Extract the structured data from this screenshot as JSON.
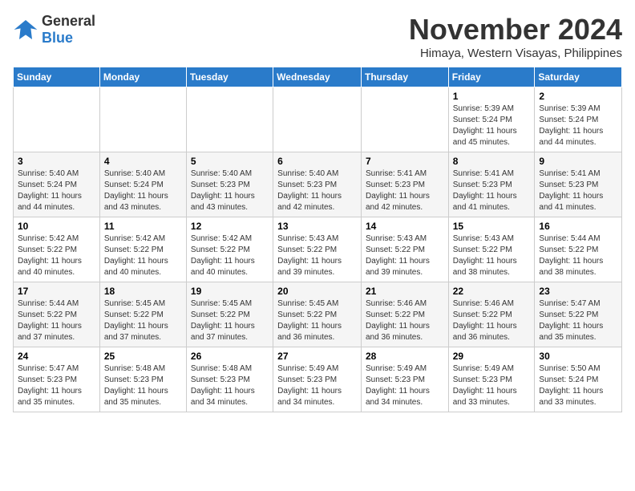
{
  "logo": {
    "line1": "General",
    "line2": "Blue"
  },
  "title": "November 2024",
  "location": "Himaya, Western Visayas, Philippines",
  "weekdays": [
    "Sunday",
    "Monday",
    "Tuesday",
    "Wednesday",
    "Thursday",
    "Friday",
    "Saturday"
  ],
  "weeks": [
    [
      {
        "day": "",
        "info": ""
      },
      {
        "day": "",
        "info": ""
      },
      {
        "day": "",
        "info": ""
      },
      {
        "day": "",
        "info": ""
      },
      {
        "day": "",
        "info": ""
      },
      {
        "day": "1",
        "info": "Sunrise: 5:39 AM\nSunset: 5:24 PM\nDaylight: 11 hours and 45 minutes."
      },
      {
        "day": "2",
        "info": "Sunrise: 5:39 AM\nSunset: 5:24 PM\nDaylight: 11 hours and 44 minutes."
      }
    ],
    [
      {
        "day": "3",
        "info": "Sunrise: 5:40 AM\nSunset: 5:24 PM\nDaylight: 11 hours and 44 minutes."
      },
      {
        "day": "4",
        "info": "Sunrise: 5:40 AM\nSunset: 5:24 PM\nDaylight: 11 hours and 43 minutes."
      },
      {
        "day": "5",
        "info": "Sunrise: 5:40 AM\nSunset: 5:23 PM\nDaylight: 11 hours and 43 minutes."
      },
      {
        "day": "6",
        "info": "Sunrise: 5:40 AM\nSunset: 5:23 PM\nDaylight: 11 hours and 42 minutes."
      },
      {
        "day": "7",
        "info": "Sunrise: 5:41 AM\nSunset: 5:23 PM\nDaylight: 11 hours and 42 minutes."
      },
      {
        "day": "8",
        "info": "Sunrise: 5:41 AM\nSunset: 5:23 PM\nDaylight: 11 hours and 41 minutes."
      },
      {
        "day": "9",
        "info": "Sunrise: 5:41 AM\nSunset: 5:23 PM\nDaylight: 11 hours and 41 minutes."
      }
    ],
    [
      {
        "day": "10",
        "info": "Sunrise: 5:42 AM\nSunset: 5:22 PM\nDaylight: 11 hours and 40 minutes."
      },
      {
        "day": "11",
        "info": "Sunrise: 5:42 AM\nSunset: 5:22 PM\nDaylight: 11 hours and 40 minutes."
      },
      {
        "day": "12",
        "info": "Sunrise: 5:42 AM\nSunset: 5:22 PM\nDaylight: 11 hours and 40 minutes."
      },
      {
        "day": "13",
        "info": "Sunrise: 5:43 AM\nSunset: 5:22 PM\nDaylight: 11 hours and 39 minutes."
      },
      {
        "day": "14",
        "info": "Sunrise: 5:43 AM\nSunset: 5:22 PM\nDaylight: 11 hours and 39 minutes."
      },
      {
        "day": "15",
        "info": "Sunrise: 5:43 AM\nSunset: 5:22 PM\nDaylight: 11 hours and 38 minutes."
      },
      {
        "day": "16",
        "info": "Sunrise: 5:44 AM\nSunset: 5:22 PM\nDaylight: 11 hours and 38 minutes."
      }
    ],
    [
      {
        "day": "17",
        "info": "Sunrise: 5:44 AM\nSunset: 5:22 PM\nDaylight: 11 hours and 37 minutes."
      },
      {
        "day": "18",
        "info": "Sunrise: 5:45 AM\nSunset: 5:22 PM\nDaylight: 11 hours and 37 minutes."
      },
      {
        "day": "19",
        "info": "Sunrise: 5:45 AM\nSunset: 5:22 PM\nDaylight: 11 hours and 37 minutes."
      },
      {
        "day": "20",
        "info": "Sunrise: 5:45 AM\nSunset: 5:22 PM\nDaylight: 11 hours and 36 minutes."
      },
      {
        "day": "21",
        "info": "Sunrise: 5:46 AM\nSunset: 5:22 PM\nDaylight: 11 hours and 36 minutes."
      },
      {
        "day": "22",
        "info": "Sunrise: 5:46 AM\nSunset: 5:22 PM\nDaylight: 11 hours and 36 minutes."
      },
      {
        "day": "23",
        "info": "Sunrise: 5:47 AM\nSunset: 5:22 PM\nDaylight: 11 hours and 35 minutes."
      }
    ],
    [
      {
        "day": "24",
        "info": "Sunrise: 5:47 AM\nSunset: 5:23 PM\nDaylight: 11 hours and 35 minutes."
      },
      {
        "day": "25",
        "info": "Sunrise: 5:48 AM\nSunset: 5:23 PM\nDaylight: 11 hours and 35 minutes."
      },
      {
        "day": "26",
        "info": "Sunrise: 5:48 AM\nSunset: 5:23 PM\nDaylight: 11 hours and 34 minutes."
      },
      {
        "day": "27",
        "info": "Sunrise: 5:49 AM\nSunset: 5:23 PM\nDaylight: 11 hours and 34 minutes."
      },
      {
        "day": "28",
        "info": "Sunrise: 5:49 AM\nSunset: 5:23 PM\nDaylight: 11 hours and 34 minutes."
      },
      {
        "day": "29",
        "info": "Sunrise: 5:49 AM\nSunset: 5:23 PM\nDaylight: 11 hours and 33 minutes."
      },
      {
        "day": "30",
        "info": "Sunrise: 5:50 AM\nSunset: 5:24 PM\nDaylight: 11 hours and 33 minutes."
      }
    ]
  ]
}
